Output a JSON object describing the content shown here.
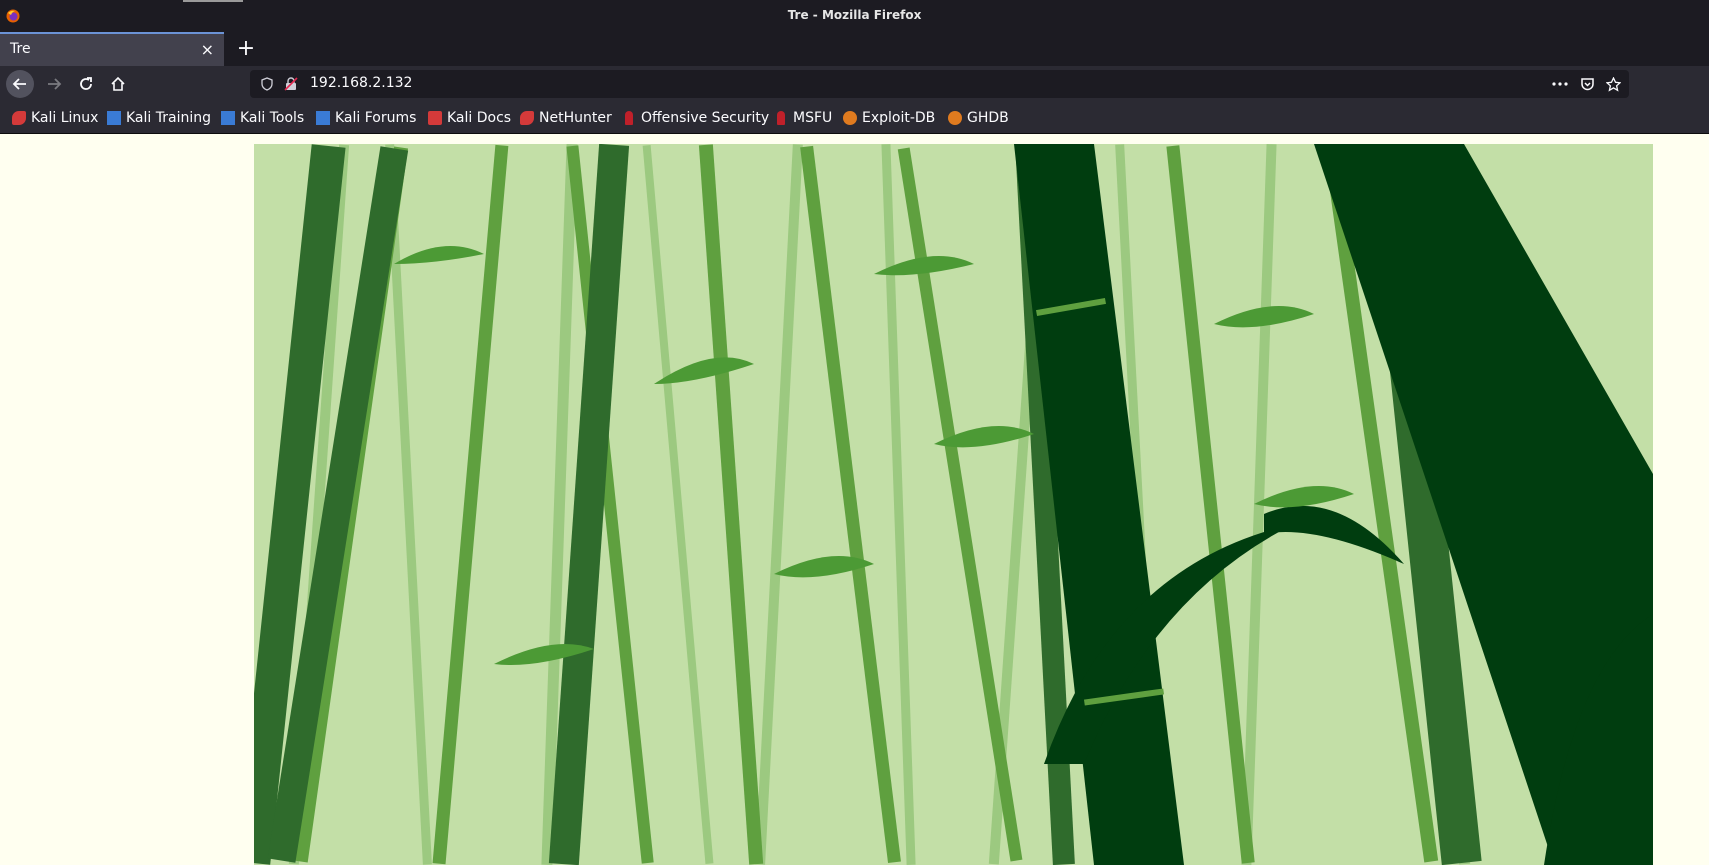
{
  "window": {
    "title": "Tre - Mozilla Firefox"
  },
  "tabs": [
    {
      "label": "Tre",
      "close": "×"
    }
  ],
  "new_tab_label": "+",
  "url": "192.168.2.132",
  "bookmarks": [
    {
      "label": "Kali Linux",
      "icon": "kali-dragon-icon",
      "color": "#d43a3a"
    },
    {
      "label": "Kali Training",
      "icon": "kali-training-icon",
      "color": "#3a7bd5"
    },
    {
      "label": "Kali Tools",
      "icon": "kali-tools-icon",
      "color": "#3a7bd5"
    },
    {
      "label": "Kali Forums",
      "icon": "kali-forums-icon",
      "color": "#3a7bd5"
    },
    {
      "label": "Kali Docs",
      "icon": "kali-docs-icon",
      "color": "#d43a3a"
    },
    {
      "label": "NetHunter",
      "icon": "nethunter-icon",
      "color": "#d43a3a"
    },
    {
      "label": "Offensive Security",
      "icon": "offsec-icon",
      "color": "#c0202a"
    },
    {
      "label": "MSFU",
      "icon": "msfu-icon",
      "color": "#c0202a"
    },
    {
      "label": "Exploit-DB",
      "icon": "exploit-db-icon",
      "color": "#e07b1f"
    },
    {
      "label": "GHDB",
      "icon": "ghdb-icon",
      "color": "#e07b1f"
    }
  ],
  "colors": {
    "page_background": "#fffff0",
    "bamboo_light": "#c3dfa7",
    "bamboo_dark": "#003d0f",
    "bamboo_mid": "#2f6b2c"
  }
}
